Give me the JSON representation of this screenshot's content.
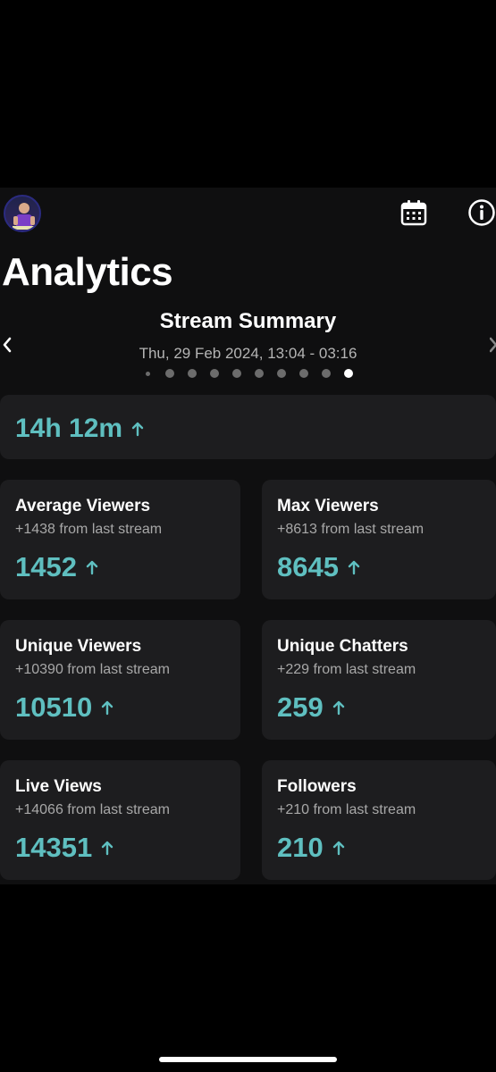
{
  "header": {
    "title": "Analytics",
    "avatar_icon": "avatar",
    "calendar_icon": "calendar-icon",
    "info_icon": "info-icon"
  },
  "summary": {
    "title": "Stream Summary",
    "date": "Thu, 29 Feb 2024, 13:04 - 03:16",
    "page_count": 10,
    "active_page": 10
  },
  "duration": {
    "value": "14h 12m"
  },
  "stats": [
    {
      "label": "Average Viewers",
      "sub": "+1438 from last stream",
      "value": "1452"
    },
    {
      "label": "Max Viewers",
      "sub": "+8613 from last stream",
      "value": "8645"
    },
    {
      "label": "Unique Viewers",
      "sub": "+10390 from last stream",
      "value": "10510"
    },
    {
      "label": "Unique Chatters",
      "sub": "+229 from last stream",
      "value": "259"
    },
    {
      "label": "Live Views",
      "sub": "+14066 from last stream",
      "value": "14351"
    },
    {
      "label": "Followers",
      "sub": "+210 from last stream",
      "value": "210"
    }
  ],
  "colors": {
    "accent": "#5fbfc0",
    "card": "#1d1d1f",
    "background": "#0f0f10"
  }
}
